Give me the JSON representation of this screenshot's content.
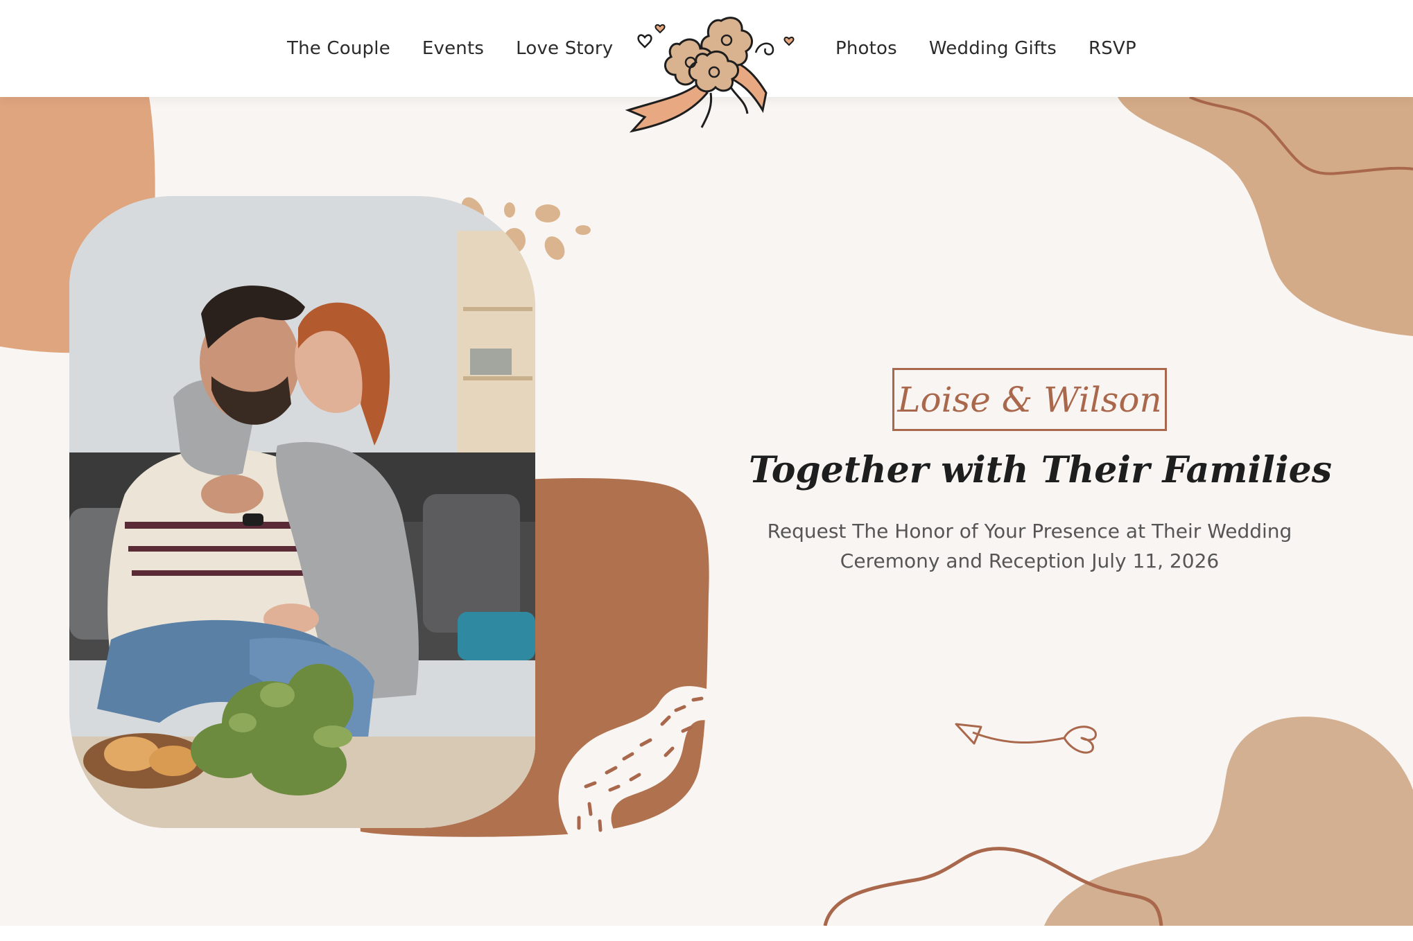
{
  "nav": {
    "left": [
      "The Couple",
      "Events",
      "Love Story"
    ],
    "right": [
      "Photos",
      "Wedding Gifts",
      "RSVP"
    ]
  },
  "hero": {
    "names": "Loise & Wilson",
    "headline": "Together with Their Families",
    "subtitle": "Request The Honor of Your Presence at Their Wedding Ceremony and Reception July 11, 2026"
  },
  "colors": {
    "accent": "#a9674b",
    "peach": "#dea57f",
    "tan": "#d4b092",
    "rust": "#b0714f",
    "cream": "#f9f5f2"
  },
  "icons": [
    "bouquet-logo-icon",
    "arrow-icon"
  ]
}
